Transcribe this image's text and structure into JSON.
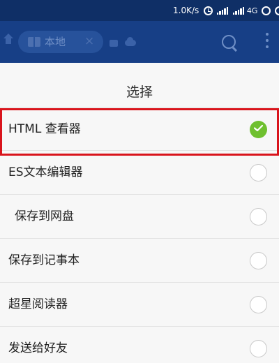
{
  "status_bar": {
    "network_speed": "1.0K/s",
    "network_type": "4G",
    "icons": [
      "alarm-icon",
      "signal-icon",
      "signal-icon",
      "sync-icon",
      "battery-icon"
    ]
  },
  "app_bar": {
    "tab_label": "本地",
    "tab_close": "×",
    "icons": [
      "home-icon",
      "book-icon",
      "close-icon",
      "window-icon",
      "cloud-icon",
      "search-icon",
      "more-icon"
    ]
  },
  "dialog": {
    "title": "选择",
    "options": [
      {
        "label": "HTML 查看器",
        "selected": true
      },
      {
        "label": "ES文本编辑器",
        "selected": false
      },
      {
        "label": "保存到网盘",
        "selected": false
      },
      {
        "label": "保存到记事本",
        "selected": false
      },
      {
        "label": "超星阅读器",
        "selected": false
      },
      {
        "label": "发送给好友",
        "selected": false
      }
    ]
  },
  "colors": {
    "status_bar": "#0f2f66",
    "app_bar": "#173f86",
    "check": "#6fc02f",
    "highlight": "#d9141c"
  }
}
